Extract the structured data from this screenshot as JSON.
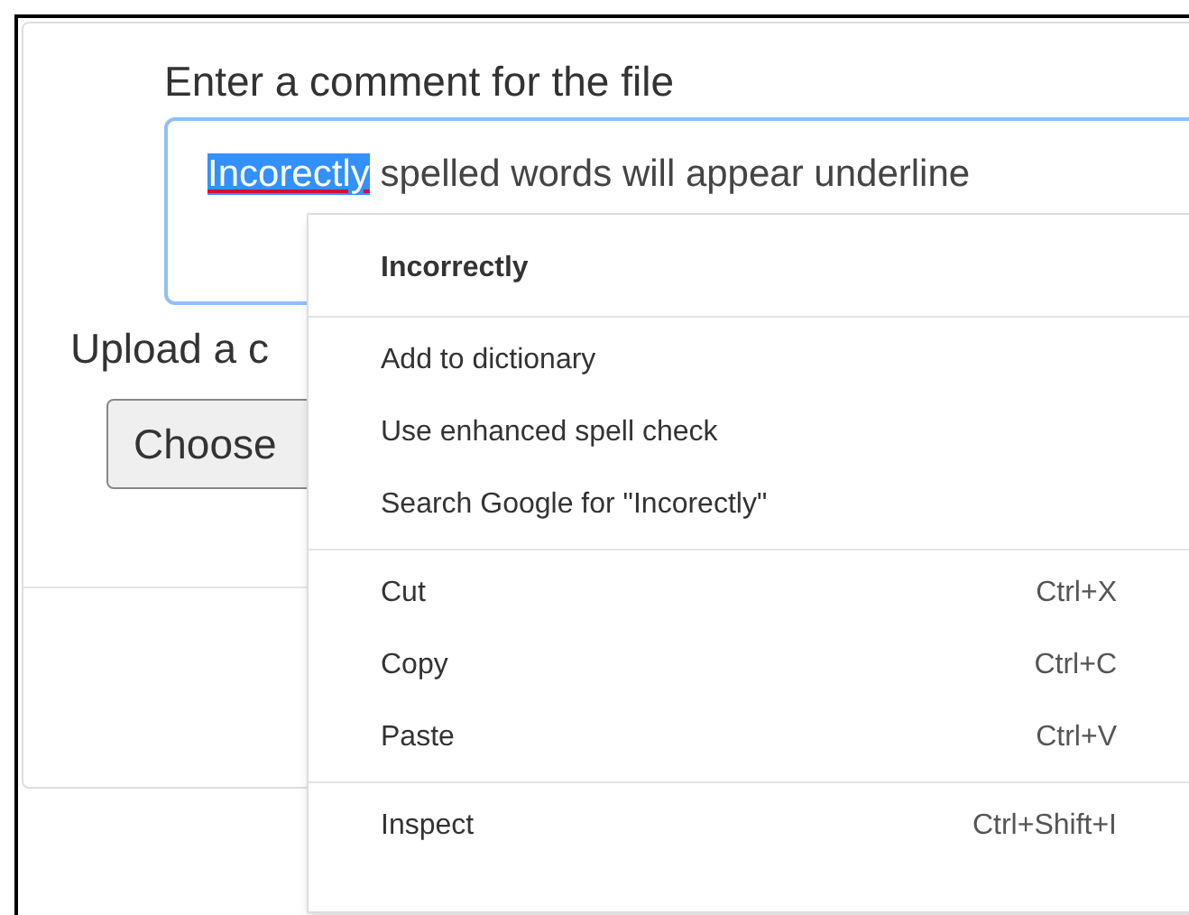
{
  "form": {
    "comment_label": "Enter a comment for the file",
    "comment_field": {
      "parts": [
        {
          "text": "Incorectly",
          "selected": true,
          "misspelled": true
        },
        {
          "text": " spelled words will appear underline",
          "selected": false,
          "misspelled": false
        }
      ]
    },
    "upload_label": "Upload a c",
    "choose_button": "Choose"
  },
  "context_menu": {
    "sections": [
      {
        "items": [
          {
            "kind": "suggestion",
            "label": "Incorrectly"
          }
        ]
      },
      {
        "items": [
          {
            "kind": "item",
            "label": "Add to dictionary"
          },
          {
            "kind": "item",
            "label": "Use enhanced spell check"
          },
          {
            "kind": "item",
            "label": "Search Google for \"Incorectly\""
          }
        ]
      },
      {
        "items": [
          {
            "kind": "item",
            "label": "Cut",
            "shortcut": "Ctrl+X"
          },
          {
            "kind": "item",
            "label": "Copy",
            "shortcut": "Ctrl+C"
          },
          {
            "kind": "item",
            "label": "Paste",
            "shortcut": "Ctrl+V"
          }
        ]
      },
      {
        "items": [
          {
            "kind": "item",
            "label": "Inspect",
            "shortcut": "Ctrl+Shift+I"
          }
        ]
      }
    ]
  }
}
